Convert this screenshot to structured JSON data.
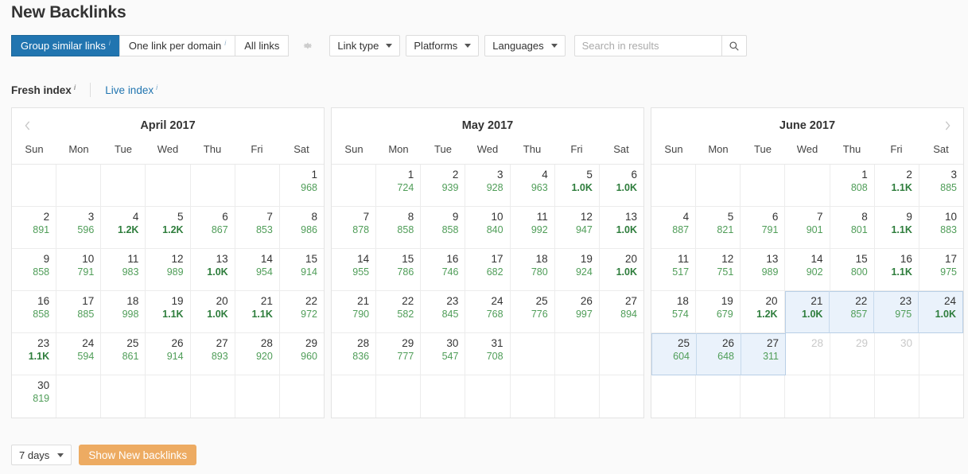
{
  "header": {
    "title": "New Backlinks"
  },
  "toolbar": {
    "segments": [
      {
        "label": "Group similar links",
        "info": "i",
        "active": true
      },
      {
        "label": "One link per domain",
        "info": "i",
        "active": false
      },
      {
        "label": "All links",
        "info": "",
        "active": false
      }
    ],
    "gear_icon": "gear-icon",
    "dropdowns": [
      {
        "label": "Link type"
      },
      {
        "label": "Platforms"
      },
      {
        "label": "Languages"
      }
    ],
    "search": {
      "value": "",
      "placeholder": "Search in results",
      "icon": "search-icon"
    }
  },
  "index_tabs": {
    "fresh": {
      "label": "Fresh index",
      "info": "i"
    },
    "live": {
      "label": "Live index",
      "info": "i"
    }
  },
  "footer": {
    "range_select": {
      "value": "7 days"
    },
    "show_button": "Show New backlinks",
    "button_color": "#edab62"
  },
  "colors": {
    "accent_blue": "#2175b0",
    "value_green": "#4f9d58",
    "value_green_bold": "#2e7d3c",
    "selection_bg": "#eaf2fb",
    "selection_border": "#b9cfe6",
    "orange": "#edab62"
  },
  "calendar": {
    "dow": [
      "Sun",
      "Mon",
      "Tue",
      "Wed",
      "Thu",
      "Fri",
      "Sat"
    ],
    "months": [
      {
        "title": "April 2017",
        "prev_arrow": true,
        "next_arrow": false,
        "weeks": [
          [
            {
              "day": "",
              "value": ""
            },
            {
              "day": "",
              "value": ""
            },
            {
              "day": "",
              "value": ""
            },
            {
              "day": "",
              "value": ""
            },
            {
              "day": "",
              "value": ""
            },
            {
              "day": "",
              "value": ""
            },
            {
              "day": "1",
              "value": "968"
            }
          ],
          [
            {
              "day": "2",
              "value": "891"
            },
            {
              "day": "3",
              "value": "596"
            },
            {
              "day": "4",
              "value": "1.2K",
              "bold": true
            },
            {
              "day": "5",
              "value": "1.2K",
              "bold": true
            },
            {
              "day": "6",
              "value": "867"
            },
            {
              "day": "7",
              "value": "853"
            },
            {
              "day": "8",
              "value": "986"
            }
          ],
          [
            {
              "day": "9",
              "value": "858"
            },
            {
              "day": "10",
              "value": "791"
            },
            {
              "day": "11",
              "value": "983"
            },
            {
              "day": "12",
              "value": "989"
            },
            {
              "day": "13",
              "value": "1.0K",
              "bold": true
            },
            {
              "day": "14",
              "value": "954"
            },
            {
              "day": "15",
              "value": "914"
            }
          ],
          [
            {
              "day": "16",
              "value": "858"
            },
            {
              "day": "17",
              "value": "885"
            },
            {
              "day": "18",
              "value": "998"
            },
            {
              "day": "19",
              "value": "1.1K",
              "bold": true
            },
            {
              "day": "20",
              "value": "1.0K",
              "bold": true
            },
            {
              "day": "21",
              "value": "1.1K",
              "bold": true
            },
            {
              "day": "22",
              "value": "972"
            }
          ],
          [
            {
              "day": "23",
              "value": "1.1K",
              "bold": true
            },
            {
              "day": "24",
              "value": "594"
            },
            {
              "day": "25",
              "value": "861"
            },
            {
              "day": "26",
              "value": "914"
            },
            {
              "day": "27",
              "value": "893"
            },
            {
              "day": "28",
              "value": "920"
            },
            {
              "day": "29",
              "value": "960"
            }
          ],
          [
            {
              "day": "30",
              "value": "819"
            },
            {
              "day": "",
              "value": ""
            },
            {
              "day": "",
              "value": ""
            },
            {
              "day": "",
              "value": ""
            },
            {
              "day": "",
              "value": ""
            },
            {
              "day": "",
              "value": ""
            },
            {
              "day": "",
              "value": ""
            }
          ]
        ]
      },
      {
        "title": "May 2017",
        "prev_arrow": false,
        "next_arrow": false,
        "weeks": [
          [
            {
              "day": "",
              "value": ""
            },
            {
              "day": "1",
              "value": "724"
            },
            {
              "day": "2",
              "value": "939"
            },
            {
              "day": "3",
              "value": "928"
            },
            {
              "day": "4",
              "value": "963"
            },
            {
              "day": "5",
              "value": "1.0K",
              "bold": true
            },
            {
              "day": "6",
              "value": "1.0K",
              "bold": true
            }
          ],
          [
            {
              "day": "7",
              "value": "878"
            },
            {
              "day": "8",
              "value": "858"
            },
            {
              "day": "9",
              "value": "858"
            },
            {
              "day": "10",
              "value": "840"
            },
            {
              "day": "11",
              "value": "992"
            },
            {
              "day": "12",
              "value": "947"
            },
            {
              "day": "13",
              "value": "1.0K",
              "bold": true
            }
          ],
          [
            {
              "day": "14",
              "value": "955"
            },
            {
              "day": "15",
              "value": "786"
            },
            {
              "day": "16",
              "value": "746"
            },
            {
              "day": "17",
              "value": "682"
            },
            {
              "day": "18",
              "value": "780"
            },
            {
              "day": "19",
              "value": "924"
            },
            {
              "day": "20",
              "value": "1.0K",
              "bold": true
            }
          ],
          [
            {
              "day": "21",
              "value": "790"
            },
            {
              "day": "22",
              "value": "582"
            },
            {
              "day": "23",
              "value": "845"
            },
            {
              "day": "24",
              "value": "768"
            },
            {
              "day": "25",
              "value": "776"
            },
            {
              "day": "26",
              "value": "997"
            },
            {
              "day": "27",
              "value": "894"
            }
          ],
          [
            {
              "day": "28",
              "value": "836"
            },
            {
              "day": "29",
              "value": "777"
            },
            {
              "day": "30",
              "value": "547"
            },
            {
              "day": "31",
              "value": "708"
            },
            {
              "day": "",
              "value": ""
            },
            {
              "day": "",
              "value": ""
            },
            {
              "day": "",
              "value": ""
            }
          ],
          [
            {
              "day": "",
              "value": ""
            },
            {
              "day": "",
              "value": ""
            },
            {
              "day": "",
              "value": ""
            },
            {
              "day": "",
              "value": ""
            },
            {
              "day": "",
              "value": ""
            },
            {
              "day": "",
              "value": ""
            },
            {
              "day": "",
              "value": ""
            }
          ]
        ]
      },
      {
        "title": "June 2017",
        "prev_arrow": false,
        "next_arrow": true,
        "weeks": [
          [
            {
              "day": "",
              "value": ""
            },
            {
              "day": "",
              "value": ""
            },
            {
              "day": "",
              "value": ""
            },
            {
              "day": "",
              "value": ""
            },
            {
              "day": "1",
              "value": "808"
            },
            {
              "day": "2",
              "value": "1.1K",
              "bold": true
            },
            {
              "day": "3",
              "value": "885"
            }
          ],
          [
            {
              "day": "4",
              "value": "887"
            },
            {
              "day": "5",
              "value": "821"
            },
            {
              "day": "6",
              "value": "791"
            },
            {
              "day": "7",
              "value": "901"
            },
            {
              "day": "8",
              "value": "801"
            },
            {
              "day": "9",
              "value": "1.1K",
              "bold": true
            },
            {
              "day": "10",
              "value": "883"
            }
          ],
          [
            {
              "day": "11",
              "value": "517"
            },
            {
              "day": "12",
              "value": "751"
            },
            {
              "day": "13",
              "value": "989"
            },
            {
              "day": "14",
              "value": "902"
            },
            {
              "day": "15",
              "value": "800"
            },
            {
              "day": "16",
              "value": "1.1K",
              "bold": true
            },
            {
              "day": "17",
              "value": "975"
            }
          ],
          [
            {
              "day": "18",
              "value": "574"
            },
            {
              "day": "19",
              "value": "679"
            },
            {
              "day": "20",
              "value": "1.2K",
              "bold": true
            },
            {
              "day": "21",
              "value": "1.0K",
              "bold": true,
              "selected": true
            },
            {
              "day": "22",
              "value": "857",
              "selected": true
            },
            {
              "day": "23",
              "value": "975",
              "selected": true
            },
            {
              "day": "24",
              "value": "1.0K",
              "bold": true,
              "selected": true
            }
          ],
          [
            {
              "day": "25",
              "value": "604",
              "selected": true
            },
            {
              "day": "26",
              "value": "648",
              "selected": true
            },
            {
              "day": "27",
              "value": "311",
              "selected": true
            },
            {
              "day": "28",
              "value": "",
              "muted": true
            },
            {
              "day": "29",
              "value": "",
              "muted": true
            },
            {
              "day": "30",
              "value": "",
              "muted": true
            },
            {
              "day": "",
              "value": ""
            }
          ],
          [
            {
              "day": "",
              "value": ""
            },
            {
              "day": "",
              "value": ""
            },
            {
              "day": "",
              "value": ""
            },
            {
              "day": "",
              "value": ""
            },
            {
              "day": "",
              "value": ""
            },
            {
              "day": "",
              "value": ""
            },
            {
              "day": "",
              "value": ""
            }
          ]
        ]
      }
    ]
  }
}
